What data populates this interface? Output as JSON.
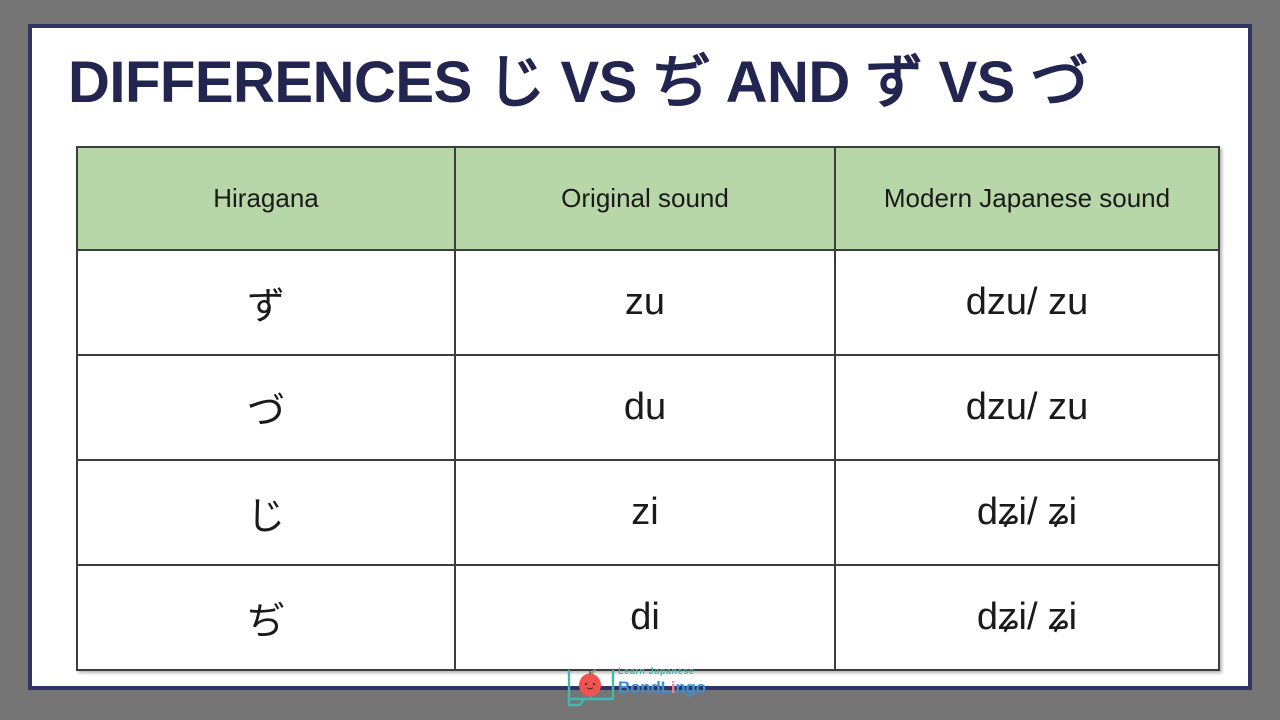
{
  "slide": {
    "title": "DIFFERENCES  じ VS ぢ AND ず VS づ",
    "background_color": "#757575",
    "card_background": "#ffffff",
    "card_border_color": "#2e3463",
    "title_color": "#22254f"
  },
  "table": {
    "header_background": "#b7d7a8",
    "border_color": "#3d3d3d",
    "headers": [
      "Hiragana",
      "Original sound",
      "Modern Japanese sound"
    ],
    "rows": [
      {
        "hiragana": "ず",
        "original": "zu",
        "modern": "dzu/ zu"
      },
      {
        "hiragana": "づ",
        "original": "du",
        "modern": "dzu/ zu"
      },
      {
        "hiragana": "じ",
        "original": "zi",
        "modern": "dʑi/ ʑi"
      },
      {
        "hiragana": "ぢ",
        "original": "di",
        "modern": "dʑi/ ʑi"
      }
    ]
  },
  "logo": {
    "line1": "Learn Japanese",
    "line2_part1": "BondL",
    "line2_accent": "i",
    "line2_part2": "ngo",
    "line1_color": "#3fb8b0",
    "line2_color": "#3b8fd4",
    "accent_color": "#f080a0"
  }
}
